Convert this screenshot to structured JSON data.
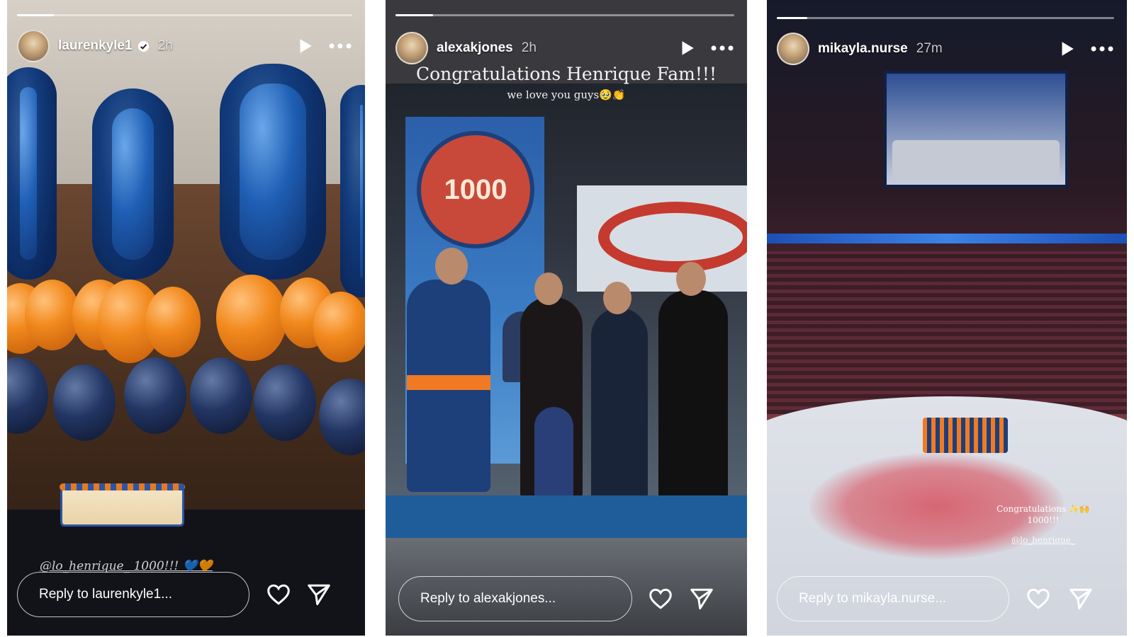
{
  "stories": [
    {
      "username": "laurenkyle1",
      "verified": true,
      "time": "2h",
      "progress": 0.11,
      "reply_placeholder": "Reply to laurenkyle1...",
      "caption": "@lo_henrique_ 1000!!! 💙🧡"
    },
    {
      "username": "alexakjones",
      "verified": false,
      "time": "2h",
      "progress": 0.11,
      "reply_placeholder": "Reply to alexakjones...",
      "caption_line1": "Congratulations Henrique Fam!!!",
      "caption_line2": "we love you guys🥹👏",
      "banner_number": "1000"
    },
    {
      "username": "mikayla.nurse",
      "verified": false,
      "time": "27m",
      "progress": 0.09,
      "reply_placeholder": "Reply to mikayla.nurse...",
      "caption_line1": "Congratulations ✨🙌",
      "caption_line2": "1000!!!",
      "caption_mention": "@lo_henrique_"
    }
  ],
  "icons": {
    "play": "play-icon",
    "more": "more-options-icon",
    "like": "heart-icon",
    "share": "send-icon",
    "verified": "verified-badge-icon"
  },
  "colors": {
    "oilers_blue": "#1d3f7a",
    "oilers_orange": "#f28a1e",
    "ui_white": "#ffffff"
  }
}
